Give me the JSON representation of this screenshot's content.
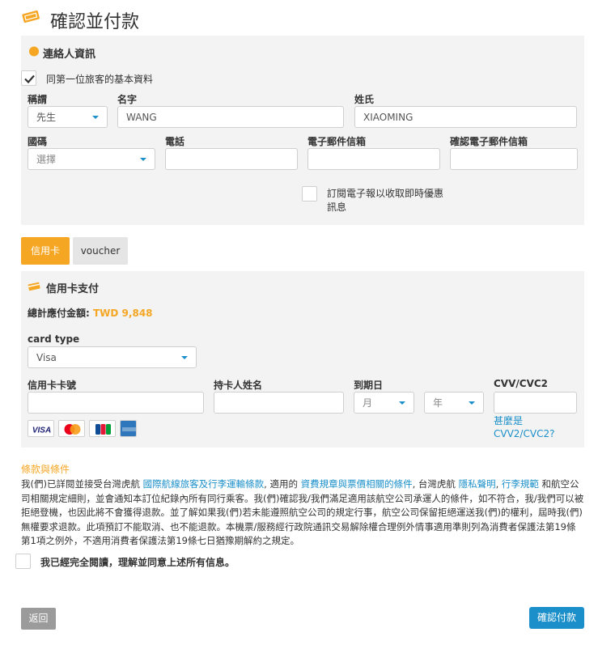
{
  "page": {
    "title": "確認並付款",
    "ticket_icon": "ticket-icon"
  },
  "contact": {
    "section_title": "連絡人資訊",
    "section_icon": "contact-person-icon",
    "same_as_first_label": "同第一位旅客的基本資料",
    "same_as_first_checked": true,
    "title_label": "稱謂",
    "title_value": "先生",
    "first_name_label": "名字",
    "first_name_value": "WANG",
    "last_name_label": "姓氏",
    "last_name_value": "XIAOMING",
    "country_code_label": "國碼",
    "country_code_placeholder": "選擇",
    "phone_label": "電話",
    "phone_value": "",
    "email_label": "電子郵件信箱",
    "email_value": "",
    "confirm_email_label": "確認電子郵件信箱",
    "confirm_email_value": "",
    "newsletter_label": "訂閱電子報以收取即時優惠訊息",
    "newsletter_checked": false
  },
  "payment_tabs": [
    {
      "label": "信用卡",
      "active": true
    },
    {
      "label": "voucher",
      "active": false
    }
  ],
  "credit_card": {
    "section_title": "信用卡支付",
    "section_icon": "credit-card-icon",
    "total_label": "總計應付金額:",
    "total_value": "TWD 9,848",
    "card_type_label": "card type",
    "card_type_value": "Visa",
    "card_number_label": "信用卡卡號",
    "card_number_value": "",
    "holder_name_label": "持卡人姓名",
    "holder_name_value": "",
    "expiry_label": "到期日",
    "expiry_month_placeholder": "月",
    "expiry_year_placeholder": "年",
    "cvv_label": "CVV/CVC2",
    "cvv_value": "",
    "cvv_help_link": "甚麼是CVV2/CVC2?",
    "card_logos": [
      "visa-logo",
      "mastercard-logo",
      "jcb-logo",
      "amex-logo"
    ]
  },
  "terms": {
    "heading": "條款與條件",
    "text_1": "我(們)已詳閱並接受台灣虎航 ",
    "link_1": "國際航線旅客及行李運輸條款",
    "text_2": ", 適用的 ",
    "link_2": "資費規章與票價相關的條件",
    "text_3": ", 台灣虎航 ",
    "link_3": "隱私聲明",
    "text_4": ", ",
    "link_4": "行李規範",
    "text_5": " 和航空公司相關規定細則，並會通知本訂位紀錄內所有同行乘客。我(們)確認我/我們滿足適用該航空公司承運人的條件，如不符合，我/我們可以被拒絕登機，也因此將不會獲得退款。並了解如果我(們)若未能遵照航空公司的規定行事，航空公司保留拒絕運送我(們)的權利，屆時我(們)無權要求退款。此項預訂不能取消、也不能退款。本機票/服務經行政院通訊交易解除權合理例外情事適用準則列為消費者保護法第19條第1項之例外，不適用消費者保護法第19條七日猶豫期解約之規定。",
    "agree_label": "我已經完全閱讀，理解並同意上述所有信息。",
    "agree_checked": false
  },
  "actions": {
    "back_label": "返回",
    "confirm_label": "確認付款"
  },
  "colors": {
    "accent": "#f5a623",
    "link": "#1a8fc9",
    "confirm_button": "#1a8fc9",
    "back_button": "#9b9b9b",
    "panel_bg": "#f3f3f3"
  }
}
